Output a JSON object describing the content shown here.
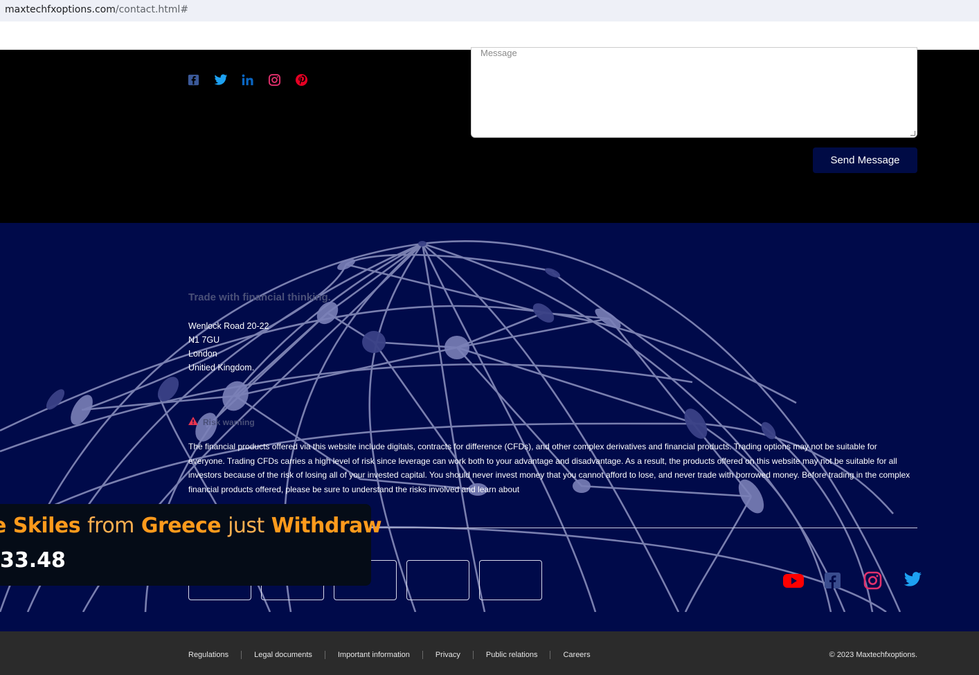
{
  "browser": {
    "url_host": "maxtechfxoptions.com",
    "url_path": "/contact.html#"
  },
  "contact": {
    "message_placeholder": "Message",
    "send_label": "Send Message",
    "social": [
      "facebook-icon",
      "twitter-icon",
      "linkedin-icon",
      "instagram-icon",
      "pinterest-icon"
    ]
  },
  "footer": {
    "tagline": "Trade with financial thinking.",
    "address": [
      "Wenlock Road 20-22",
      "N1 7GU",
      "London",
      "Unitied Kingdom."
    ],
    "risk_title": "Risk warning",
    "risk_text": "The financial products offered via this website include digitals, contracts for difference (CFDs), and other complex derivatives and financial products. Trading options may not be suitable for everyone. Trading CFDs carries a high level of risk since leverage can work both to your advantage and disadvantage. As a result, the products offered on this website may not be suitable for all investors because of the risk of losing all of your invested capital. You should never invest money that you cannot afford to lose, and never trade with borrowed money. Before trading in the complex financial products offered, please be sure to understand the risks involved and learn about",
    "social": [
      "youtube-icon",
      "facebook-icon",
      "instagram-icon",
      "twitter-icon"
    ]
  },
  "toast": {
    "name": "e Skiles",
    "from": "from",
    "country": "Greece",
    "just": "just",
    "action": "Withdraw",
    "amount": "33.48"
  },
  "bottom": {
    "links": [
      "Regulations",
      "Legal documents",
      "Important information",
      "Privacy",
      "Public relations",
      "Careers"
    ],
    "copyright": "© 2023 Maxtechfxoptions."
  },
  "colors": {
    "footer_bg": "#000a4a",
    "send_bg": "#000b45",
    "toast_accent": "#ff9a1c",
    "bottom_bg": "#2b2b2b"
  }
}
